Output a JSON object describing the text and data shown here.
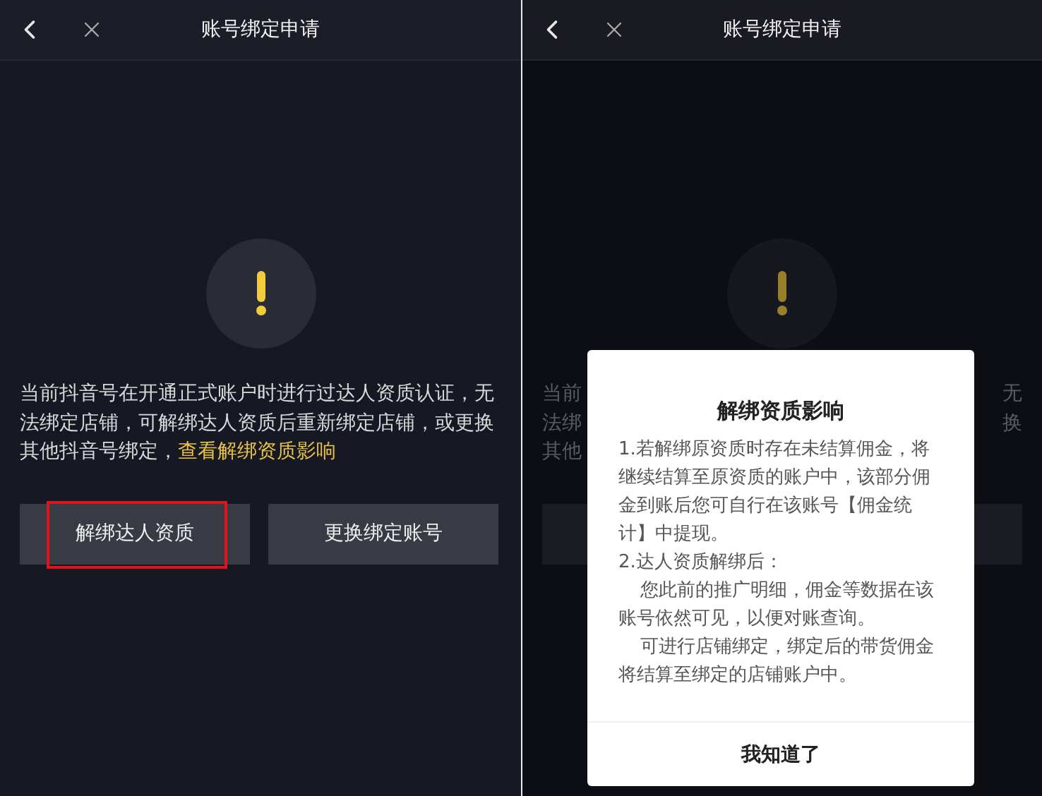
{
  "screens": [
    {
      "kind": "page",
      "header": {
        "title": "账号绑定申请"
      },
      "message": {
        "text": "当前抖音号在开通正式账户时进行过达人资质认证，无法绑定店铺，可解绑达人资质后重新绑定店铺，或更换其他抖音号绑定，",
        "link": "查看解绑资质影响"
      },
      "buttons": [
        {
          "label": "解绑达人资质",
          "highlighted": true
        },
        {
          "label": "更换绑定账号",
          "highlighted": false
        }
      ]
    },
    {
      "kind": "dialog_open",
      "header": {
        "title": "账号绑定申请"
      },
      "background_fragments": {
        "left": [
          "当前",
          "法绑",
          "其他"
        ],
        "right": [
          "无",
          "换"
        ]
      },
      "dialog": {
        "title": "解绑资质影响",
        "paragraphs": [
          {
            "text": "1.若解绑原资质时存在未结算佣金，将继续结算至原资质的账户中，该部分佣金到账后您可自行在该账号【佣金统计】中提现。",
            "indent": false
          },
          {
            "text": "2.达人资质解绑后：",
            "indent": false
          },
          {
            "text": "您此前的推广明细，佣金等数据在该账号依然可见，以便对账查询。",
            "indent": true
          },
          {
            "text": "可进行店铺绑定，绑定后的带货佣金将结算至绑定的店铺账户中。",
            "indent": true
          }
        ],
        "button": "我知道了"
      }
    }
  ]
}
